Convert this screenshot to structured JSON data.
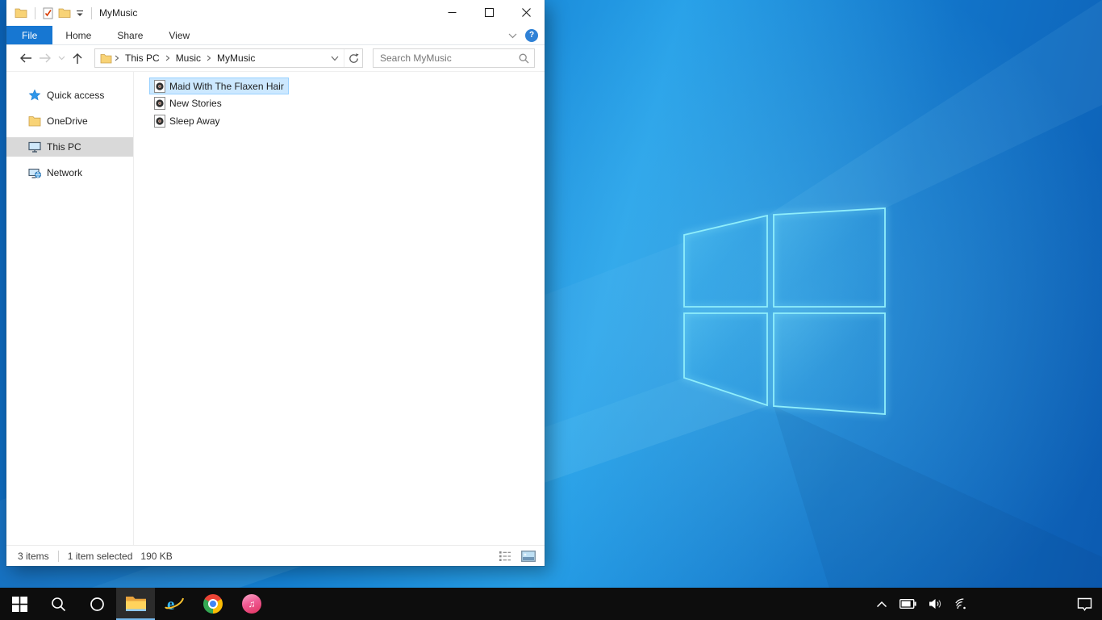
{
  "colors": {
    "accent_file_tab": "#1777d2",
    "selection_bg": "#cce8ff",
    "selection_border": "#99d1ff",
    "sidebar_selected_bg": "#d9d9d9",
    "taskbar_bg": "#0d0d0d",
    "taskbar_active_underline": "#76b9ed",
    "wallpaper_base": "#1480d2",
    "wallpaper_bright": "#27a0e8",
    "logo_edge": "#8feefb"
  },
  "window": {
    "title": "MyMusic",
    "qat": {
      "window_icon": "folder-icon",
      "buttons": [
        "properties",
        "new-folder",
        "customize-quick-access-toolbar"
      ]
    },
    "controls": [
      "minimize",
      "maximize",
      "close"
    ],
    "ribbon": {
      "tabs": [
        {
          "label": "File",
          "active": true
        },
        {
          "label": "Home",
          "active": false
        },
        {
          "label": "Share",
          "active": false
        },
        {
          "label": "View",
          "active": false
        }
      ],
      "expand_icon": "chevron-down",
      "help_icon": "help",
      "help_glyph": "?"
    },
    "toolbar": {
      "nav": [
        "back",
        "forward",
        "recent-locations-chevron",
        "up"
      ],
      "breadcrumb": {
        "icon": "folder-icon",
        "items": [
          "This PC",
          "Music",
          "MyMusic"
        ]
      },
      "address_controls": [
        "address-dropdown-chevron",
        "refresh"
      ],
      "search": {
        "placeholder": "Search MyMusic",
        "icon": "search-icon"
      }
    },
    "sidebar": {
      "items": [
        {
          "label": "Quick access",
          "icon": "quick-access-star-icon",
          "selected": false
        },
        {
          "label": "OneDrive",
          "icon": "onedrive-folder-icon",
          "selected": false
        },
        {
          "label": "This PC",
          "icon": "this-pc-monitor-icon",
          "selected": true
        },
        {
          "label": "Network",
          "icon": "network-icon",
          "selected": false
        }
      ]
    },
    "files": [
      {
        "name": "Maid With The Flaxen Hair",
        "icon": "audio-file-icon",
        "selected": true
      },
      {
        "name": "New Stories",
        "icon": "audio-file-icon",
        "selected": false
      },
      {
        "name": "Sleep Away",
        "icon": "audio-file-icon",
        "selected": false
      }
    ],
    "statusbar": {
      "items_count": "3 items",
      "selection": "1 item selected",
      "size": "190 KB",
      "views": [
        "details-view",
        "large-thumbnails-view"
      ]
    }
  },
  "taskbar": {
    "buttons": [
      {
        "name": "start",
        "active": false
      },
      {
        "name": "search",
        "active": false
      },
      {
        "name": "cortana",
        "active": false
      },
      {
        "name": "file-explorer",
        "active": true
      },
      {
        "name": "internet-explorer",
        "active": false
      },
      {
        "name": "chrome",
        "active": false
      },
      {
        "name": "itunes",
        "active": false
      }
    ],
    "tray": [
      "hidden-icons-chevron",
      "battery",
      "volume",
      "wifi"
    ],
    "action_center": "action-center"
  }
}
